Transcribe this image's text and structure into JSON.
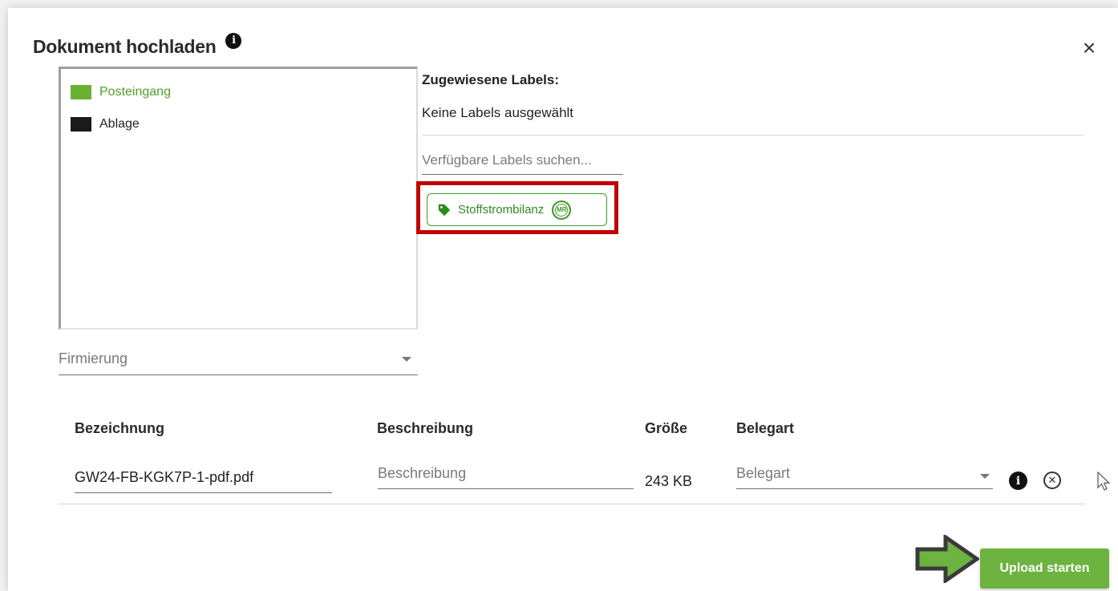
{
  "dialog": {
    "title": "Dokument hochladen",
    "info_icon": "info-icon",
    "close_icon": "close-icon",
    "close_glyph": "×"
  },
  "folders": [
    {
      "label": "Posteingang",
      "color": "#68b232",
      "active": true
    },
    {
      "label": "Ablage",
      "color": "#1a1a1a",
      "active": false
    }
  ],
  "labels": {
    "heading": "Zugewiesene Labels:",
    "none_text": "Keine Labels ausgewählt",
    "search_placeholder": "Verfügbare Labels suchen...",
    "available": [
      {
        "label": "Stoffstrombilanz",
        "icon": "tag-icon",
        "badge": "MR"
      }
    ]
  },
  "firmierung": {
    "placeholder": "Firmierung"
  },
  "table": {
    "columns": [
      "Bezeichnung",
      "Beschreibung",
      "Größe",
      "Belegart"
    ],
    "rows": [
      {
        "bezeichnung": "GW24-FB-KGK7P-1-pdf.pdf",
        "beschreibung_placeholder": "Beschreibung",
        "groesse": "243 KB",
        "belegart_placeholder": "Belegart"
      }
    ]
  },
  "actions": {
    "upload_label": "Upload starten"
  },
  "colors": {
    "accent": "#6cb33f",
    "label_green": "#3f9a2a",
    "highlight_red": "#c00000"
  }
}
